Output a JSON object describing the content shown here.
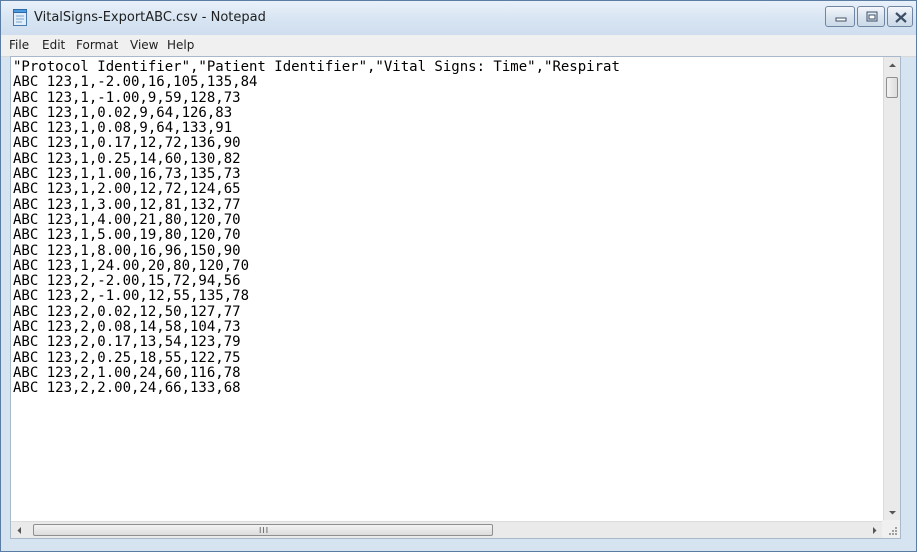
{
  "window": {
    "title": "VitalSigns-ExportABC.csv - Notepad"
  },
  "menu": {
    "items": [
      "File",
      "Edit",
      "Format",
      "View",
      "Help"
    ]
  },
  "editor": {
    "lines": [
      "\"Protocol Identifier\",\"Patient Identifier\",\"Vital Signs: Time\",\"Respirat",
      "ABC 123,1,-2.00,16,105,135,84",
      "ABC 123,1,-1.00,9,59,128,73",
      "ABC 123,1,0.02,9,64,126,83",
      "ABC 123,1,0.08,9,64,133,91",
      "ABC 123,1,0.17,12,72,136,90",
      "ABC 123,1,0.25,14,60,130,82",
      "ABC 123,1,1.00,16,73,135,73",
      "ABC 123,1,2.00,12,72,124,65",
      "ABC 123,1,3.00,12,81,132,77",
      "ABC 123,1,4.00,21,80,120,70",
      "ABC 123,1,5.00,19,80,120,70",
      "ABC 123,1,8.00,16,96,150,90",
      "ABC 123,1,24.00,20,80,120,70",
      "ABC 123,2,-2.00,15,72,94,56",
      "ABC 123,2,-1.00,12,55,135,78",
      "ABC 123,2,0.02,12,50,127,77",
      "ABC 123,2,0.08,14,58,104,73",
      "ABC 123,2,0.17,13,54,123,79",
      "ABC 123,2,0.25,18,55,122,75",
      "ABC 123,2,1.00,24,60,116,78",
      "ABC 123,2,2.00,24,66,133,68"
    ]
  },
  "scrollbars": {
    "horizontal_grip": "III"
  },
  "icons": {
    "app": "notepad-icon",
    "minimize": "minimize-icon",
    "maximize": "maximize-icon",
    "close": "close-icon"
  }
}
